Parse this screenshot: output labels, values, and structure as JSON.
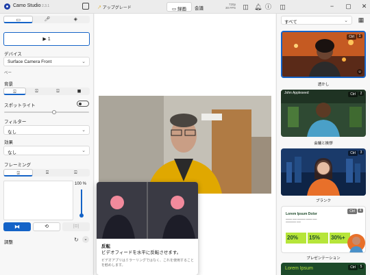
{
  "app": {
    "name": "Camo Studio",
    "version": "2.3.1",
    "upgrade": "アップグレード",
    "resolution": "720p",
    "fps": "30 FPS"
  },
  "header": {
    "tab_draw": "録画",
    "tab_meeting": "会議"
  },
  "left": {
    "source_label": "1",
    "device_label": "デバイス",
    "device_value": "Surface Camera Front",
    "more": "ベー",
    "background_label": "背景",
    "spotlight_label": "スポットライト",
    "filter_label": "フィルター",
    "filter_value": "なし",
    "effect_label": "効果",
    "effect_value": "なし",
    "framing_label": "フレーミング",
    "zoom_value": "100 %",
    "adjust_label": "調整"
  },
  "tooltip": {
    "title": "反転",
    "body": "ビデオフィードを水平に反転させます。",
    "note": "ビデオアプリはミラーリングではなく、これを使用することを勧めします。"
  },
  "right": {
    "filter_value": "すべて",
    "thumbs": [
      {
        "label": "透かし",
        "ctrl": "Ctrl",
        "num": "1"
      },
      {
        "label": "会議と挨拶",
        "ctrl": "Ctrl",
        "num": "2",
        "overlay_name": "John Appleseed"
      },
      {
        "label": "ブランク",
        "ctrl": "Ctrl",
        "num": "3"
      },
      {
        "label": "プレゼンテーション",
        "ctrl": "Ctrl",
        "num": "4",
        "slide_title": "Lorem Ipsum Dolor",
        "stats": [
          "20%",
          "15%",
          "30%+"
        ]
      },
      {
        "label": "",
        "ctrl": "Ctrl",
        "num": "5",
        "slide_title": "Lorem Ipsum"
      }
    ]
  },
  "colors": {
    "accent": "#1463c7",
    "green": "#b6e53a",
    "dark_green": "#1d4a2a"
  }
}
